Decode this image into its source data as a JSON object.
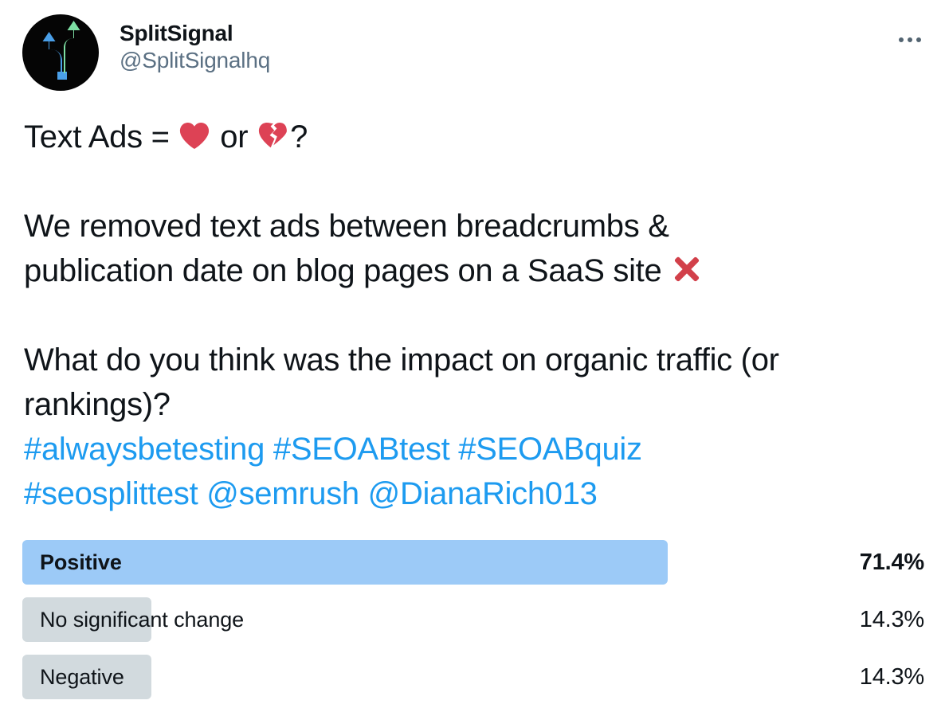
{
  "account": {
    "display_name": "SplitSignal",
    "handle": "@SplitSignalhq",
    "avatar_icon": "split-arrows-icon",
    "avatar_bg": "#050505",
    "avatar_arrow_blue": "#4a9fe8",
    "avatar_arrow_green": "#7ddfa3"
  },
  "header": {
    "more_icon": "more-options-icon"
  },
  "tweet": {
    "line1_pre": "Text Ads = ",
    "line1_mid": " or ",
    "line1_post": "?",
    "heart_emoji": "red-heart-emoji",
    "broken_heart_emoji": "broken-heart-emoji",
    "cross_emoji": "cross-mark-emoji",
    "para2_line1": "We removed text ads between breadcrumbs &",
    "para2_line2_pre": "publication date on blog pages on a SaaS site ",
    "para3_line1": "What do you think was the impact on organic traffic (or",
    "para3_line2": "rankings)?",
    "tags_line1": "#alwaysbetesting #SEOABtest #SEOABquiz",
    "tags_line2": "#seosplittest @semrush @DianaRich013",
    "link_color": "#1d9bf0",
    "text_color": "#0f1419"
  },
  "poll": {
    "winner_color": "#9ccaf7",
    "other_color": "#d2dade",
    "options": [
      {
        "label": "Positive",
        "percent": "71.4%",
        "value": 71.4,
        "winner": true
      },
      {
        "label": "No significant change",
        "percent": "14.3%",
        "value": 14.3,
        "winner": false
      },
      {
        "label": "Negative",
        "percent": "14.3%",
        "value": 14.3,
        "winner": false
      }
    ]
  }
}
